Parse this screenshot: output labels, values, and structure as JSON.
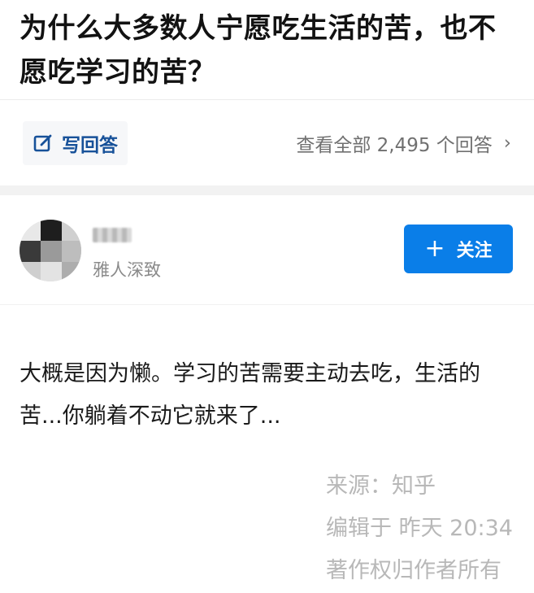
{
  "question": {
    "title": "为什么大多数人宁愿吃生活的苦，也不愿吃学习的苦？"
  },
  "actions": {
    "write_answer_label": "写回答",
    "view_all_label": "查看全部 2,495 个回答",
    "chevron": "›"
  },
  "author": {
    "description": "雅人深致"
  },
  "follow": {
    "plus": "+",
    "label": "关注"
  },
  "answer": {
    "text": "大概是因为懒。学习的苦需要主动去吃，生活的苦...你躺着不动它就来了..."
  },
  "footer": {
    "source": "来源：知乎",
    "edited": "编辑于 昨天 20:34",
    "copyright": "著作权归作者所有"
  },
  "colors": {
    "accent": "#0a7ee8",
    "link": "#175199",
    "muted": "#8a8a8a"
  }
}
